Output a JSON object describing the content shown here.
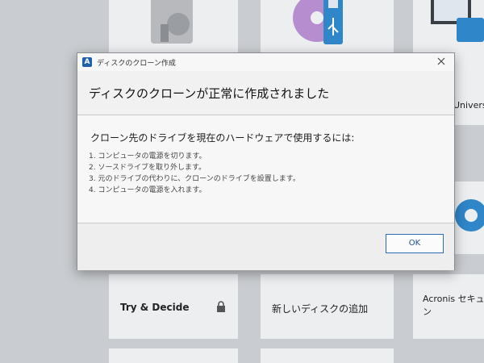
{
  "window": {
    "title": "ディスクのクローン作成",
    "logo_letter": "A"
  },
  "dialog": {
    "heading": "ディスクのクローンが正常に作成されました",
    "content_heading": "クローン先のドライブを現在のハードウェアで使用するには:",
    "steps": [
      "1. コンピュータの電源を切ります。",
      "2. ソースドライブを取り外します。",
      "3. 元のドライブの代わりに、クローンのドライブを設置します。",
      "4. コンピュータの電源を入れます。"
    ],
    "ok_label": "OK"
  },
  "background": {
    "universal_label": "Universa",
    "try_decide_label": "Try & Decide",
    "add_disk_label": "新しいディスクの追加",
    "acronis_label_line1": "Acronis セキュア",
    "acronis_label_line2": "ン"
  },
  "colors": {
    "accent": "#1f5fae",
    "ok_border": "#2d6bb8"
  }
}
